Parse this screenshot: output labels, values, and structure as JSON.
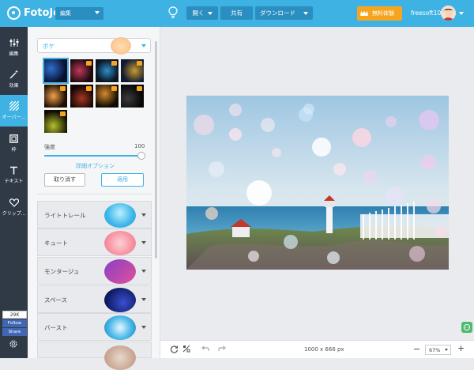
{
  "header": {
    "logo_text": "FotoJet",
    "mode_select": "編集",
    "open_label": "開く",
    "share_label": "共有",
    "download_label": "ダウンロード",
    "trial_label": "無料体験",
    "username": "freesoft100"
  },
  "nav": [
    {
      "label": "編集",
      "icon": "sliders-icon"
    },
    {
      "label": "効果",
      "icon": "magic-wand-icon"
    },
    {
      "label": "オーバー...",
      "icon": "overlay-stripes-icon"
    },
    {
      "label": "枠",
      "icon": "frame-icon"
    },
    {
      "label": "テキスト",
      "icon": "text-icon"
    },
    {
      "label": "クリップ...",
      "icon": "heart-icon"
    }
  ],
  "social": {
    "count": "29K",
    "follow": "Follow",
    "share": "Share"
  },
  "panel": {
    "category_dropdown": "ボケ",
    "strength_label": "強度",
    "strength_value": "100",
    "strength_fraction": 1.0,
    "detail_link": "詳細オプション",
    "cancel_label": "取り消す",
    "apply_label": "適用",
    "categories": [
      {
        "label": "ライトトレール"
      },
      {
        "label": "キュート"
      },
      {
        "label": "モンタージュ"
      },
      {
        "label": "スペース"
      },
      {
        "label": "バースト"
      }
    ]
  },
  "canvas": {
    "dimensions": "1000 x 666 px",
    "zoom": "67%"
  },
  "colors": {
    "accent": "#3fb2e4",
    "nav_bg": "#2f3a46",
    "trial": "#f7a51f"
  }
}
